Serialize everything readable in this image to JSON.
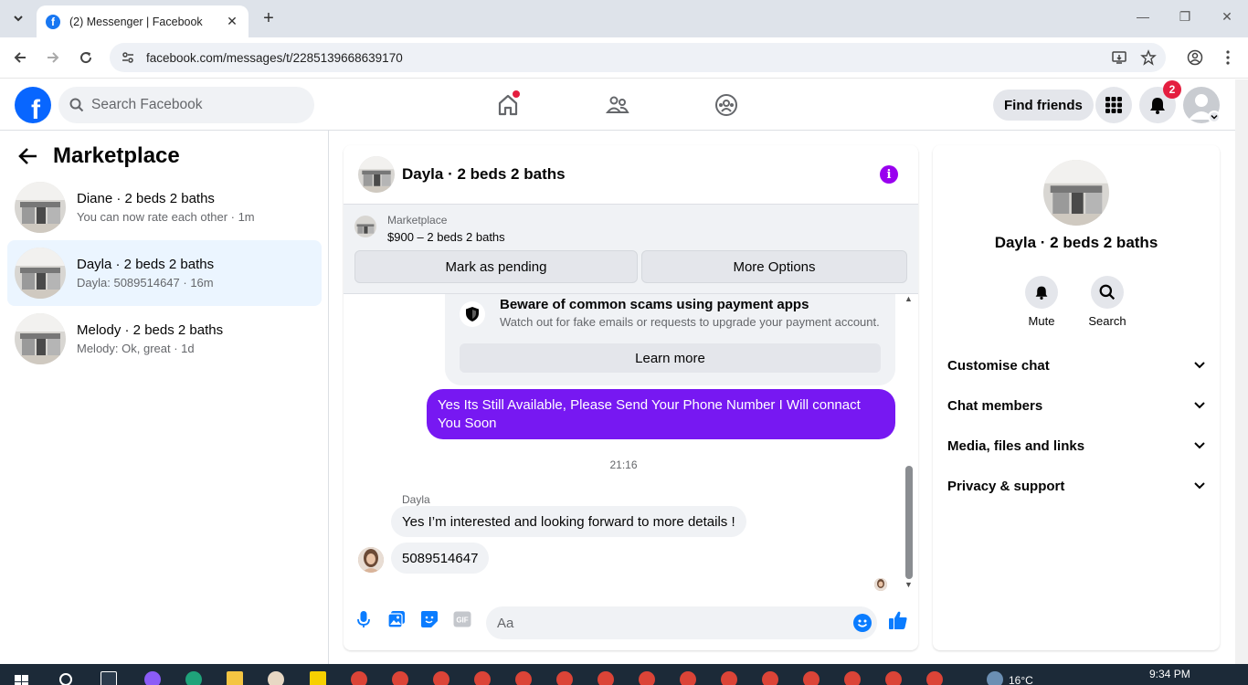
{
  "browser": {
    "tab_title": "(2) Messenger | Facebook",
    "url": "facebook.com/messages/t/2285139668639170"
  },
  "fb": {
    "search_placeholder": "Search Facebook",
    "find_friends": "Find friends",
    "notification_count": "2"
  },
  "sidebar": {
    "title": "Marketplace",
    "conversations": [
      {
        "name": "Diane · 2 beds 2 baths",
        "preview": "You can now rate each other · 1m"
      },
      {
        "name": "Dayla · 2 beds 2 baths",
        "preview": "Dayla: 5089514647 · 16m"
      },
      {
        "name": "Melody · 2 beds 2 baths",
        "preview": "Melody: Ok, great · 1d"
      }
    ]
  },
  "chat": {
    "title": "Dayla · 2 beds 2 baths",
    "listing": {
      "label": "Marketplace",
      "price_title": "$900 – 2 beds 2 baths",
      "mark_pending": "Mark as pending",
      "more_options": "More Options"
    },
    "scam_notice": {
      "title": "Beware of common scams using payment apps",
      "text": "Watch out for fake emails or requests to upgrade your payment account.",
      "button": "Learn more"
    },
    "outgoing_message": "Yes Its Still Available, Please Send Your Phone Number I Will connact You Soon",
    "timestamp": "21:16",
    "sender": "Dayla",
    "incoming_messages": [
      "Yes I’m interested and looking forward to more details !",
      "5089514647"
    ],
    "composer_placeholder": "Aa"
  },
  "info_panel": {
    "name": "Dayla · 2 beds 2 baths",
    "actions": [
      "Mute",
      "Search"
    ],
    "sections": [
      "Customise chat",
      "Chat members",
      "Media, files and links",
      "Privacy & support"
    ]
  },
  "taskbar": {
    "temperature": "16°C",
    "time": "9:34 PM"
  },
  "colors": {
    "fb_blue": "#0866ff",
    "outgoing_bubble": "#7718f2",
    "info_icon": "#9900ef",
    "active_conversation": "#ebf5ff"
  }
}
